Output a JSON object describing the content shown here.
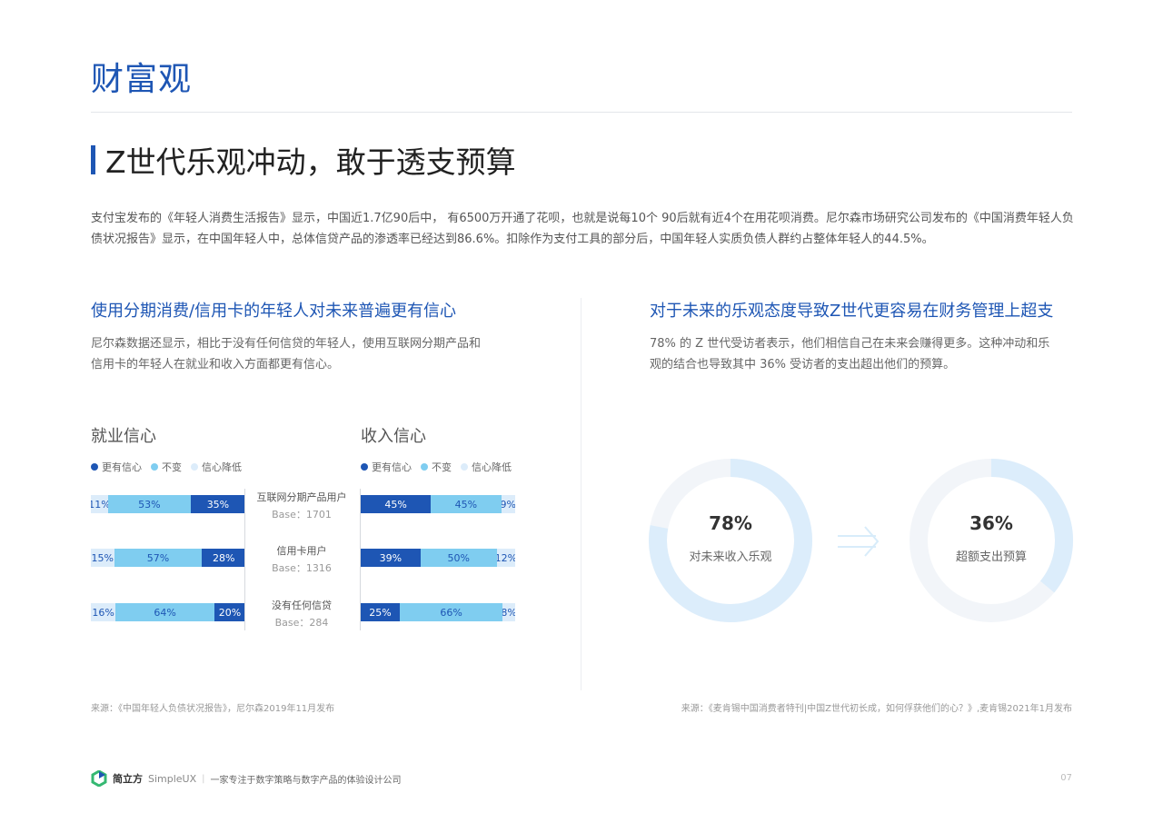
{
  "page": {
    "title": "财富观",
    "section_title": "Z世代乐观冲动，敢于透支预算",
    "intro": "支付宝发布的《年轻人消费生活报告》显示，中国近1.7亿90后中， 有6500万开通了花呗，也就是说每10个 90后就有近4个在用花呗消费。尼尔森市场研究公司发布的《中国消费年轻人负债状况报告》显示，在中国年轻人中，总体信贷产品的渗透率已经达到86.6%。扣除作为支付工具的部分后，中国年轻人实质负债人群约占整体年轻人的44.5%。"
  },
  "left": {
    "title": "使用分期消费/信用卡的年轻人对未来普遍更有信心",
    "desc_line1": "尼尔森数据还显示，相比于没有任何信贷的年轻人，使用互联网分期产品和",
    "desc_line2": "信用卡的年轻人在就业和收入方面都更有信心。",
    "source": "来源：《中国年轻人负债状况报告》，尼尔森2019年11月发布"
  },
  "right": {
    "title": "对于未来的乐观态度导致Z世代更容易在财务管理上超支",
    "desc_line1": "78% 的 Z 世代受访者表示，他们相信自己在未来会赚得更多。这种冲动和乐",
    "desc_line2": "观的结合也导致其中 36% 受访者的支出超出他们的预算。",
    "source": "来源：《麦肯锡中国消费者特刊|中国Z世代初长成，如何俘获他们的心？》,麦肯锡2021年1月发布"
  },
  "chart_data": [
    {
      "type": "bar",
      "title": "就业信心",
      "stacked": true,
      "direction": "right-to-left",
      "categories": [
        "互联网分期产品用户",
        "信用卡用户",
        "没有任何信贷"
      ],
      "bases": [
        "Base：1701",
        "Base：1316",
        "Base：284"
      ],
      "series": [
        {
          "name": "更有信心",
          "values": [
            35,
            28,
            20
          ],
          "color": "#1e56b4"
        },
        {
          "name": "不变",
          "values": [
            53,
            57,
            64
          ],
          "color": "#7fcdf0"
        },
        {
          "name": "信心降低",
          "values": [
            11,
            15,
            16
          ],
          "color": "#dcecfa"
        }
      ],
      "legend_position": "top-left"
    },
    {
      "type": "bar",
      "title": "收入信心",
      "stacked": true,
      "direction": "left-to-right",
      "categories": [
        "互联网分期产品用户",
        "信用卡用户",
        "没有任何信贷"
      ],
      "series": [
        {
          "name": "更有信心",
          "values": [
            45,
            39,
            25
          ],
          "color": "#1e56b4"
        },
        {
          "name": "不变",
          "values": [
            45,
            50,
            66
          ],
          "color": "#7fcdf0"
        },
        {
          "name": "信心降低",
          "values": [
            9,
            12,
            8
          ],
          "color": "#dcecfa"
        }
      ],
      "legend_position": "top-left"
    },
    {
      "type": "pie",
      "donut": true,
      "value": 78,
      "value_label": "78%",
      "label": "对未来收入乐观",
      "colors": [
        "#dcedfb",
        "#f2f5f9"
      ]
    },
    {
      "type": "pie",
      "donut": true,
      "value": 36,
      "value_label": "36%",
      "label": "超额支出预算",
      "colors": [
        "#dcedfb",
        "#f2f5f9"
      ]
    }
  ],
  "footer": {
    "brand": "简立方",
    "brand_en": "SimpleUX",
    "separator": "|",
    "tagline": "一家专注于数字策略与数字产品的体验设计公司",
    "page_number": "07"
  },
  "colors": {
    "accent": "#1e56b4",
    "mid": "#7fcdf0",
    "light": "#dcecfa",
    "logo_green": "#35b872"
  }
}
